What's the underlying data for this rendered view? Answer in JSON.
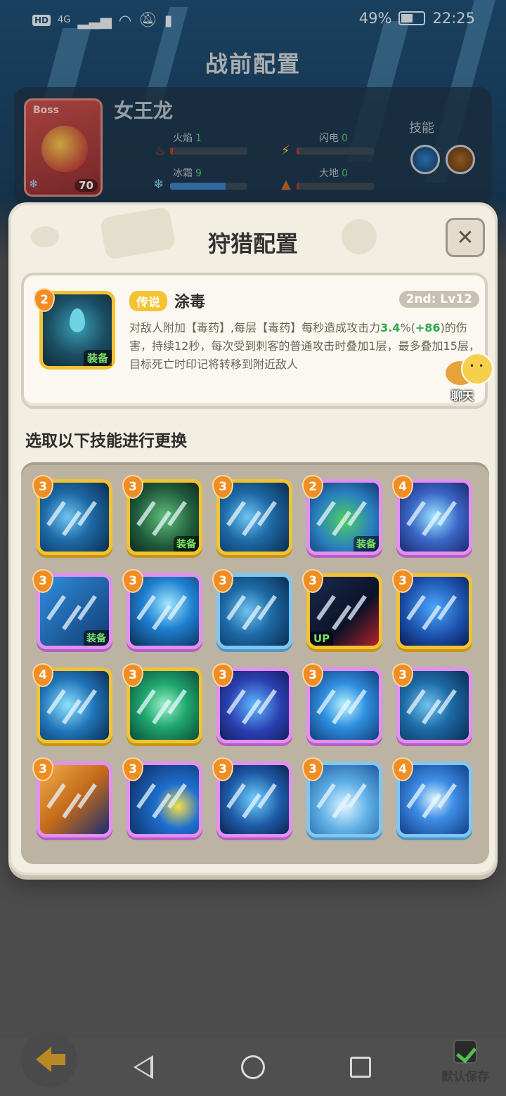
{
  "status_bar": {
    "network": "HD",
    "signal": "4G",
    "battery_percent": "49%",
    "time": "22:25"
  },
  "screen": {
    "title": "战前配置"
  },
  "enemy": {
    "boss_tag": "Boss",
    "name": "女王龙",
    "level": "70",
    "stats": [
      {
        "label": "火焰",
        "value": "1",
        "fill": 0.04
      },
      {
        "label": "闪电",
        "value": "0",
        "fill": 0.03
      },
      {
        "label": "冰霜",
        "value": "9",
        "fill": 0.72
      },
      {
        "label": "大地",
        "value": "0",
        "fill": 0.03
      }
    ],
    "skills_label": "技能"
  },
  "modal": {
    "title": "狩猎配置",
    "close_icon": "close-icon",
    "selected_skill": {
      "level_badge": "2",
      "equip_tag": "装备",
      "rarity": "传说",
      "name": "涂毒",
      "level": "2nd: Lv12",
      "desc_a": "对敌人附加【毒药】,每层【毒药】每秒造成攻击力",
      "desc_pct": "3.4",
      "desc_b": "%(",
      "desc_plus": "+86",
      "desc_c": ")的伤害，持续12秒，每次受到刺客的普通攻击时叠加1层，最多叠加15层，目标死亡时印记将转移到附近敌人"
    },
    "chat_label": "聊天",
    "choose_label": "选取以下技能进行更换",
    "grid": [
      {
        "badge": "3",
        "frame": "gold",
        "tag": "",
        "art": "blades"
      },
      {
        "badge": "3",
        "frame": "gold",
        "tag": "装备",
        "art": "skull"
      },
      {
        "badge": "3",
        "frame": "gold",
        "tag": "",
        "art": "blades"
      },
      {
        "badge": "2",
        "frame": "purple",
        "tag": "装备",
        "art": "bush"
      },
      {
        "badge": "4",
        "frame": "purple",
        "tag": "",
        "art": "swirl"
      },
      {
        "badge": "3",
        "frame": "purple",
        "tag": "装备",
        "art": "hit"
      },
      {
        "badge": "3",
        "frame": "purple",
        "tag": "",
        "art": "slash"
      },
      {
        "badge": "3",
        "frame": "blue",
        "tag": "",
        "art": "blades"
      },
      {
        "badge": "3",
        "frame": "gold",
        "tag": "UP",
        "art": "dark"
      },
      {
        "badge": "3",
        "frame": "gold",
        "tag": "",
        "art": "ghost"
      },
      {
        "badge": "4",
        "frame": "gold",
        "tag": "",
        "art": "kunai"
      },
      {
        "badge": "3",
        "frame": "gold",
        "tag": "",
        "art": "green"
      },
      {
        "badge": "3",
        "frame": "purple",
        "tag": "",
        "art": "dagger"
      },
      {
        "badge": "3",
        "frame": "purple",
        "tag": "",
        "art": "sword"
      },
      {
        "badge": "3",
        "frame": "purple",
        "tag": "",
        "art": "blades"
      },
      {
        "badge": "3",
        "frame": "purple",
        "tag": "",
        "art": "fist"
      },
      {
        "badge": "3",
        "frame": "purple",
        "tag": "",
        "art": "strike"
      },
      {
        "badge": "3",
        "frame": "purple",
        "tag": "",
        "art": "ghost2"
      },
      {
        "badge": "3",
        "frame": "blue",
        "tag": "",
        "art": "spikes"
      },
      {
        "badge": "4",
        "frame": "blue",
        "tag": "",
        "art": "vortex"
      }
    ]
  },
  "bottom": {
    "save_default_label": "默认保存"
  }
}
